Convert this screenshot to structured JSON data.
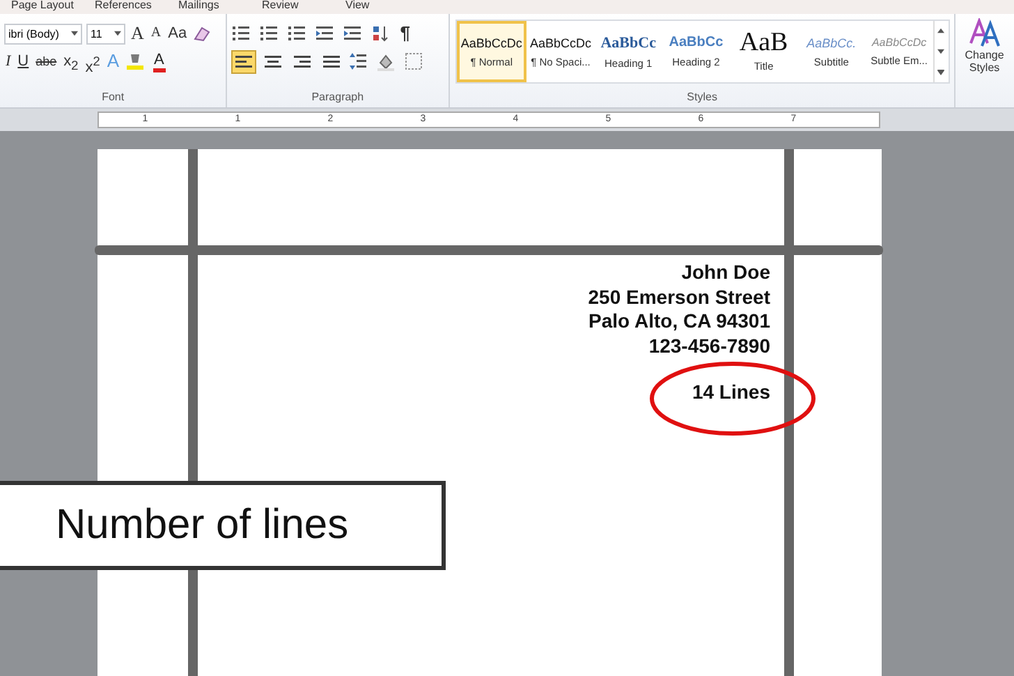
{
  "tabs": [
    {
      "label": "Page Layout",
      "selected": false
    },
    {
      "label": "References",
      "selected": false
    },
    {
      "label": "Mailings",
      "selected": false
    },
    {
      "label": "Review",
      "selected": false
    },
    {
      "label": "View",
      "selected": false
    }
  ],
  "font": {
    "name": "ibri (Body)",
    "size": "11",
    "grow": "A",
    "shrink": "A",
    "case": "Aa",
    "italic": "I",
    "underline": "U",
    "strike": "abe",
    "subscript": "x$_{2}$",
    "superscript": "x$^{2}$",
    "effects": "A",
    "font_color_letter": "A",
    "label": "Font"
  },
  "paragraph": {
    "align": [
      {
        "selected": true
      },
      {
        "selected": false
      },
      {
        "selected": false
      },
      {
        "selected": false
      }
    ],
    "pilcrow": "¶",
    "label": "Paragraph"
  },
  "styles": {
    "items": [
      {
        "sample": "AaBbCcDc",
        "label": "¶ Normal",
        "kind": "normal",
        "selected": true
      },
      {
        "sample": "AaBbCcDc",
        "label": "¶ No Spaci...",
        "kind": "normal",
        "selected": false
      },
      {
        "sample": "AaBbCc",
        "label": "Heading 1",
        "kind": "heading1",
        "selected": false
      },
      {
        "sample": "AaBbCc",
        "label": "Heading 2",
        "kind": "heading2",
        "selected": false
      },
      {
        "sample": "AaB",
        "label": "Title",
        "kind": "title",
        "selected": false
      },
      {
        "sample": "AaBbCc.",
        "label": "Subtitle",
        "kind": "subtitle",
        "selected": false
      },
      {
        "sample": "AaBbCcDc",
        "label": "Subtle Em...",
        "kind": "subtle",
        "selected": false
      }
    ],
    "label": "Styles",
    "change": "Change Styles"
  },
  "ruler": [
    "1",
    "1",
    "2",
    "3",
    "4",
    "5",
    "6",
    "7"
  ],
  "document": {
    "lines": [
      "John Doe",
      "250 Emerson Street",
      "Palo Alto, CA 94301",
      "123-456-7890"
    ],
    "note": "14 Lines"
  },
  "caption": "Number of lines"
}
